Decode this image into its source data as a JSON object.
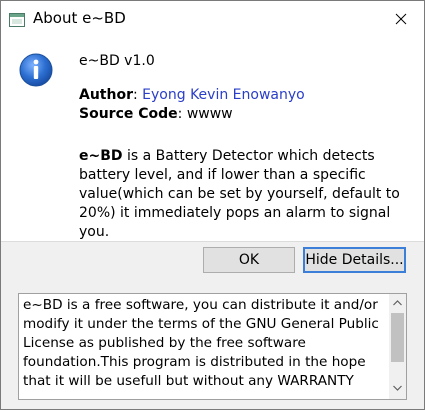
{
  "window": {
    "title": "About e~BD"
  },
  "about": {
    "version": "e~BD v1.0",
    "author_label": "Author",
    "author_name": "Eyong Kevin Enowanyo",
    "source_label": "Source Code",
    "source_value": "wwww",
    "desc_name": "e~BD",
    "description": " is a Battery Detector which detects battery level, and if lower than a specific value(which can be set by yourself, default to 20%) it immediately pops an alarm to signal you."
  },
  "buttons": {
    "ok_label": "OK",
    "hide_details_label": "Hide Details..."
  },
  "details": {
    "text": "e~BD is a free software, you can distribute it and/or modify it under the terms of the GNU General Public License as published by the free software foundation.This program is distributed in the hope that it will be usefull but without any WARRANTY"
  },
  "icons": {
    "app": "window-icon",
    "info": "info-icon",
    "close": "close-icon"
  },
  "colors": {
    "link": "#2a3ec8",
    "info_icon": "#2c6fd1",
    "focus_border": "#3c7fd8"
  }
}
